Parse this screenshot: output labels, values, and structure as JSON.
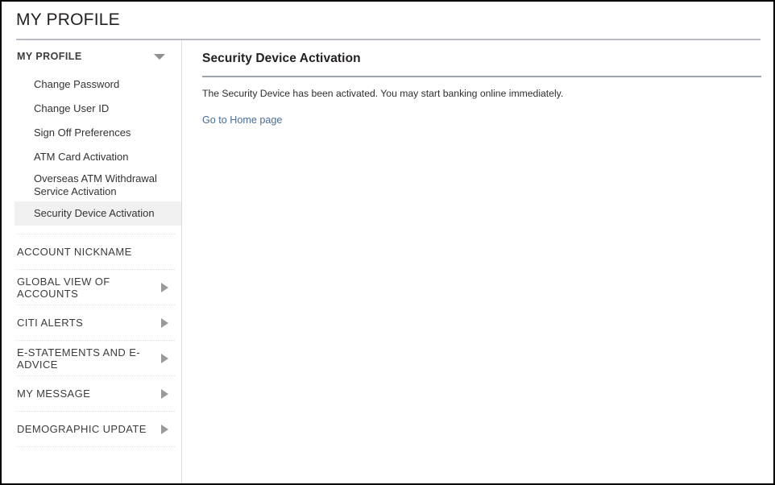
{
  "page": {
    "title": "MY PROFILE"
  },
  "sidebar": {
    "section_header": {
      "label": "MY PROFILE",
      "caret_icon": "chevron-down-icon"
    },
    "sub_items": [
      {
        "label": "Change Password",
        "selected": false
      },
      {
        "label": "Change User ID",
        "selected": false
      },
      {
        "label": "Sign Off Preferences",
        "selected": false
      },
      {
        "label": "ATM Card Activation",
        "selected": false
      },
      {
        "label": "Overseas ATM Withdrawal Service Activation",
        "selected": false
      },
      {
        "label": "Security Device Activation",
        "selected": true
      }
    ],
    "sections": [
      {
        "label": "ACCOUNT NICKNAME",
        "has_arrow": false,
        "arrow_icon": ""
      },
      {
        "label": "GLOBAL VIEW OF ACCOUNTS",
        "has_arrow": true,
        "arrow_icon": "chevron-right-icon"
      },
      {
        "label": "CITI ALERTS",
        "has_arrow": true,
        "arrow_icon": "chevron-right-icon"
      },
      {
        "label": "E-STATEMENTS AND E-ADVICE",
        "has_arrow": true,
        "arrow_icon": "chevron-right-icon"
      },
      {
        "label": "MY MESSAGE",
        "has_arrow": true,
        "arrow_icon": "chevron-right-icon"
      },
      {
        "label": "DEMOGRAPHIC UPDATE",
        "has_arrow": true,
        "arrow_icon": "chevron-right-icon"
      }
    ]
  },
  "main": {
    "heading": "Security Device Activation",
    "message": "The Security Device has been activated. You may start banking online immediately.",
    "home_link": "Go to Home page"
  },
  "colors": {
    "frame_border": "#000000",
    "header_rule": "#b9bcc1",
    "content_rule": "#9ea2ab",
    "link": "#4a6c96",
    "selected_bg": "#f1f1f1",
    "caret": "#9a9a9a"
  }
}
